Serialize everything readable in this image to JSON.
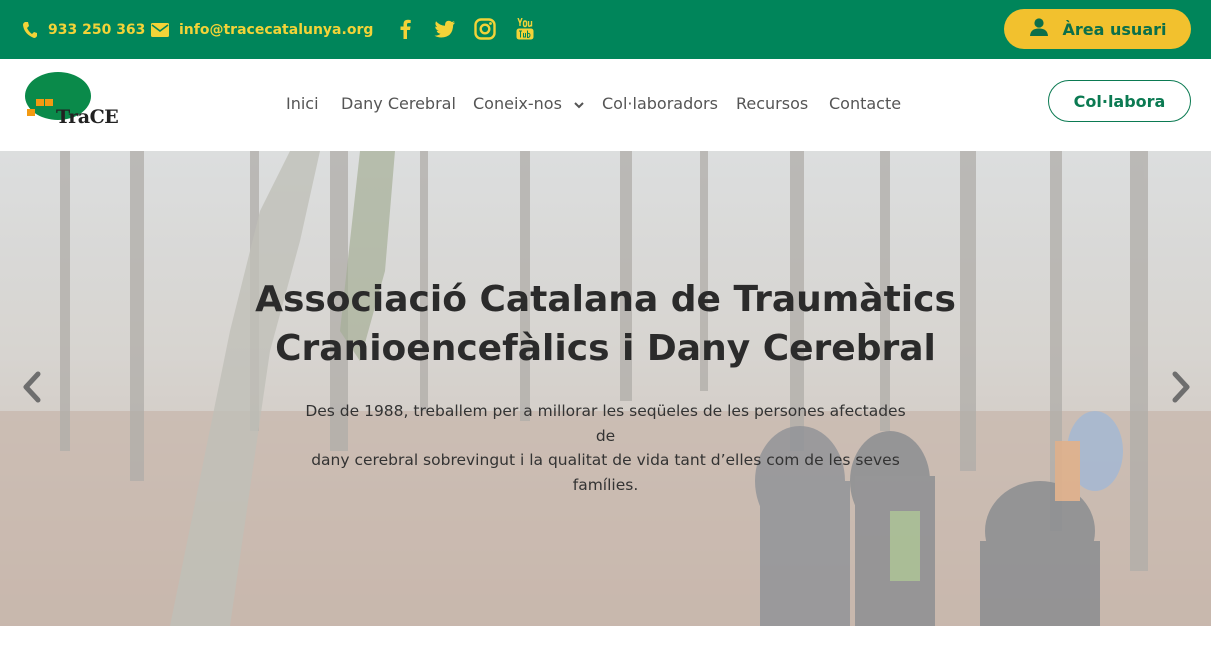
{
  "topbar": {
    "phone": "933 250 363",
    "email": "info@tracecatalunya.org",
    "social_icons": [
      "facebook-icon",
      "twitter-icon",
      "instagram-icon",
      "youtube-icon"
    ],
    "user_area_label": "Àrea usuari"
  },
  "header": {
    "logo_text": "TraCE",
    "nav": [
      "Inici",
      "Dany Cerebral",
      "Coneix-nos",
      "Col·laboradors",
      "Recursos",
      "Contacte"
    ],
    "collab_label": "Col·labora"
  },
  "hero": {
    "title_line1": "Associació Catalana de Traumàtics",
    "title_line2": "Cranioencefàlics i Dany Cerebral",
    "text_line1": "Des de 1988, treballem per a millorar les seqüeles de les persones afectades de",
    "text_line2": "dany cerebral sobrevingut i la qualitat de vida tant d’elles com de les seves",
    "text_line3": "famílies."
  },
  "colors": {
    "brand_green": "#00855a",
    "accent_yellow": "#f2c12e",
    "icon_yellow": "#f2d338"
  }
}
